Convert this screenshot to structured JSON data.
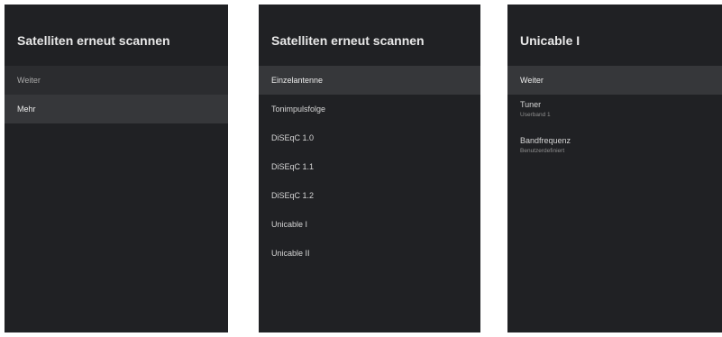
{
  "panels": [
    {
      "title": "Satelliten erneut scannen",
      "items": [
        "Weiter",
        "Mehr"
      ]
    },
    {
      "title": "Satelliten erneut scannen",
      "items": [
        "Einzelantenne",
        "Tonimpulsfolge",
        "DiSEqC 1.0",
        "DiSEqC 1.1",
        "DiSEqC 1.2",
        "Unicable I",
        "Unicable II"
      ]
    },
    {
      "title": "Unicable I",
      "items": [
        {
          "label": "Weiter"
        },
        {
          "label": "Tuner",
          "value": "Userband 1"
        },
        {
          "label": "Bandfrequenz",
          "value": "Benutzerdefiniert"
        }
      ]
    }
  ],
  "colors": {
    "panel_bg": "#202124",
    "highlight_bg": "#36373a",
    "text": "#d6d6d6",
    "subtext": "#8e8e8e"
  }
}
